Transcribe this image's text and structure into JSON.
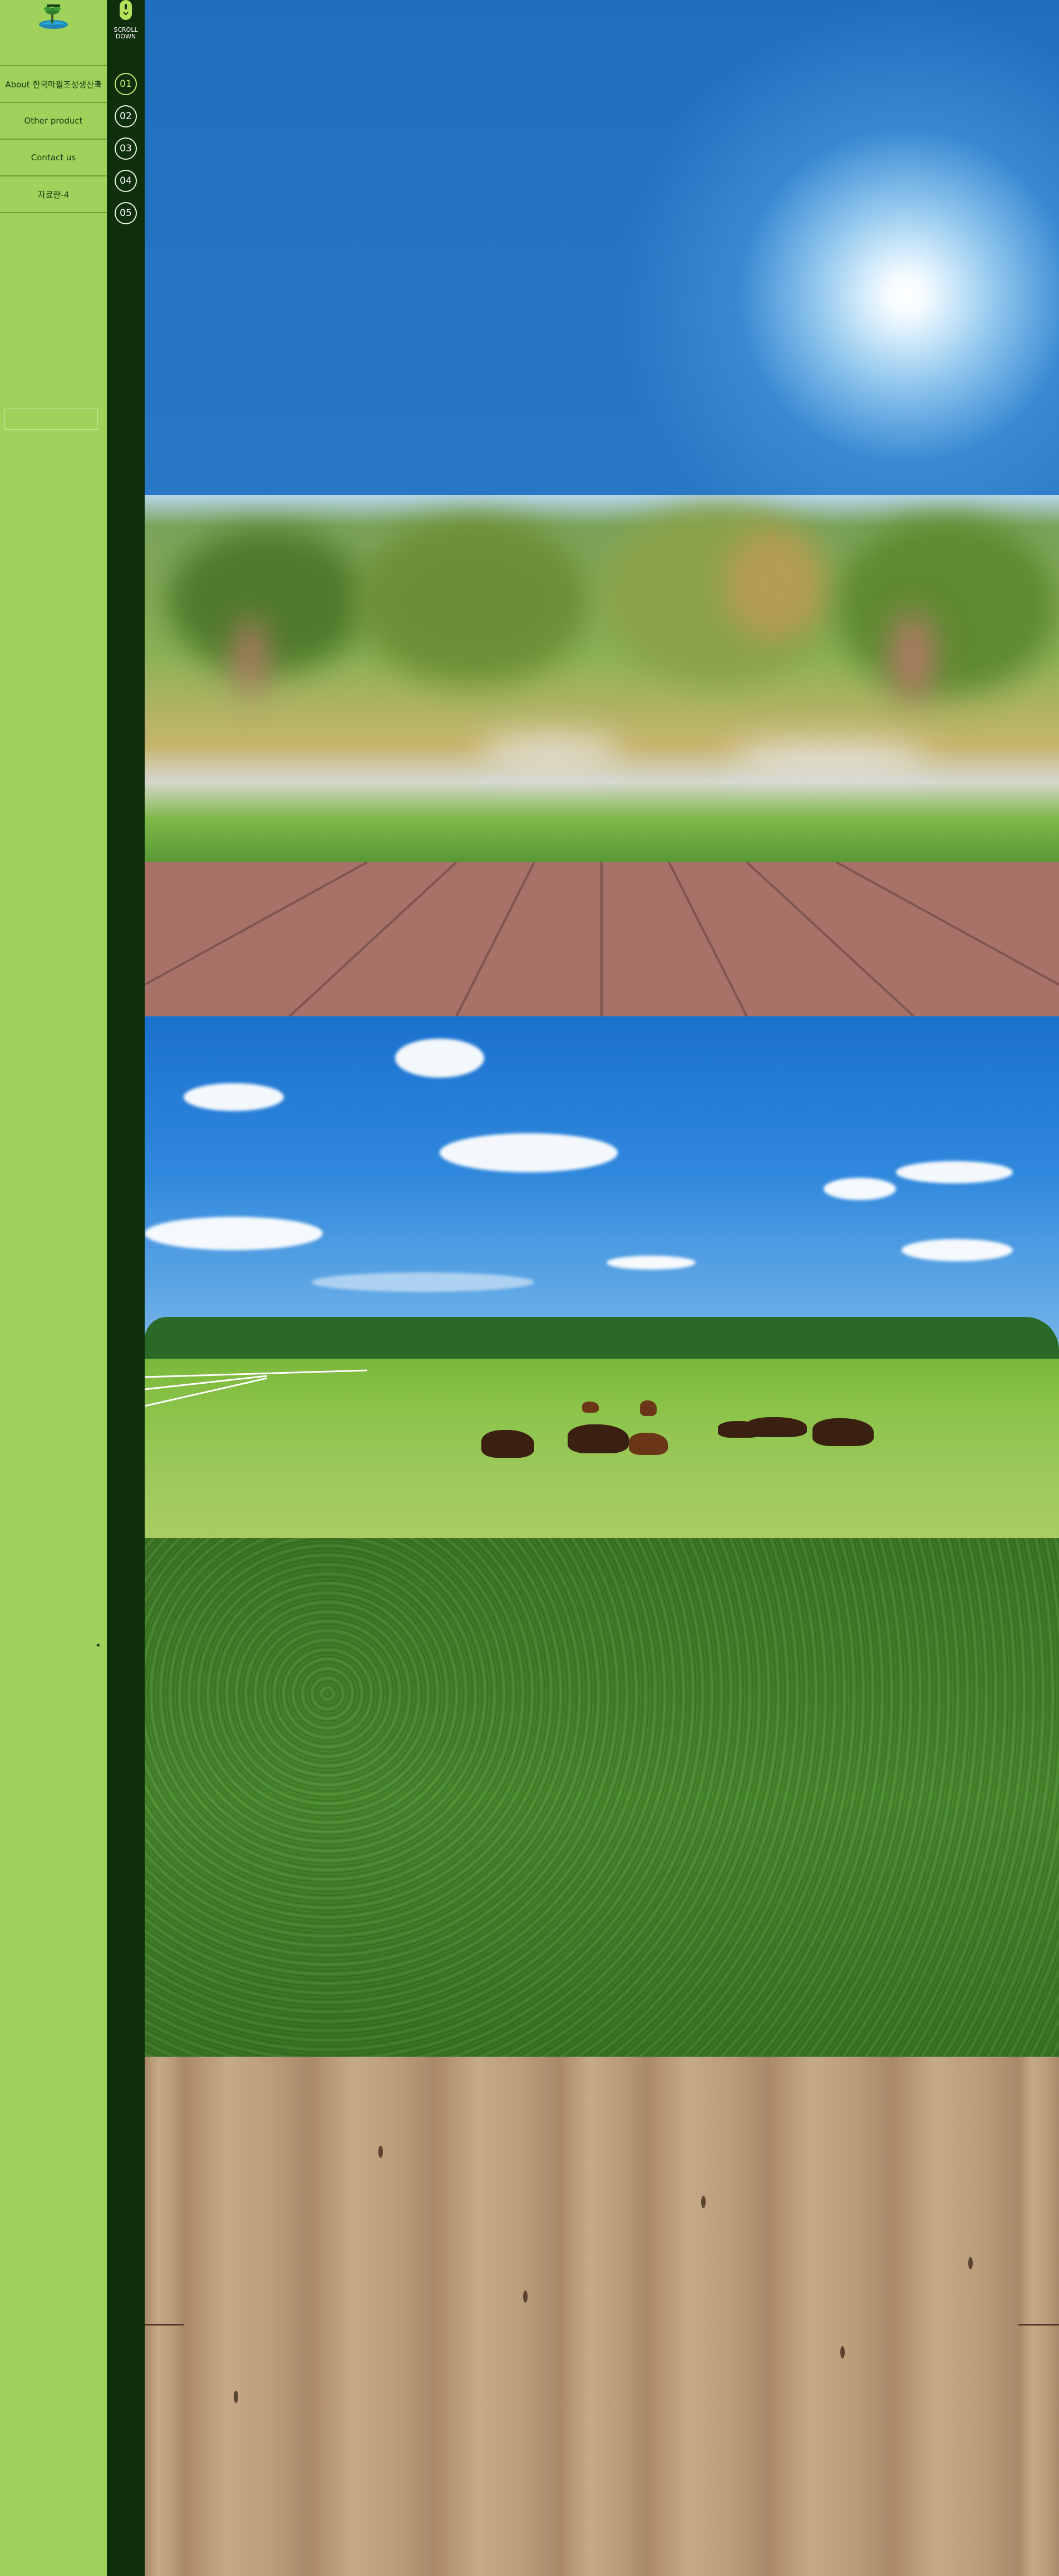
{
  "sidebar": {
    "menu": [
      {
        "label": "About 한국마필조성생산축",
        "has_submenu": true,
        "submenu_icon": "+"
      },
      {
        "label": "Other product",
        "has_submenu": false
      },
      {
        "label": "Contact us",
        "has_submenu": false
      },
      {
        "label": "자료란-4",
        "has_submenu": false
      }
    ],
    "side_arrow": "◂"
  },
  "rail": {
    "scroll_label_line1": "SCROLL",
    "scroll_label_line2": "DOWN",
    "sections": [
      "01",
      "02",
      "03",
      "04",
      "05"
    ],
    "active_section": "01"
  },
  "colors": {
    "sidebar_bg": "#9fd15b",
    "rail_bg": "#0f2e0c",
    "active_dot": "#c6e96b"
  },
  "panels": [
    {
      "id": "sky",
      "icon": "sun-sky-image"
    },
    {
      "id": "garden",
      "icon": "blurred-garden-wood-deck-image"
    },
    {
      "id": "pasture",
      "icon": "horses-pasture-image"
    },
    {
      "id": "grass",
      "icon": "grass-texture-image"
    },
    {
      "id": "wood",
      "icon": "wood-planks-image"
    }
  ]
}
